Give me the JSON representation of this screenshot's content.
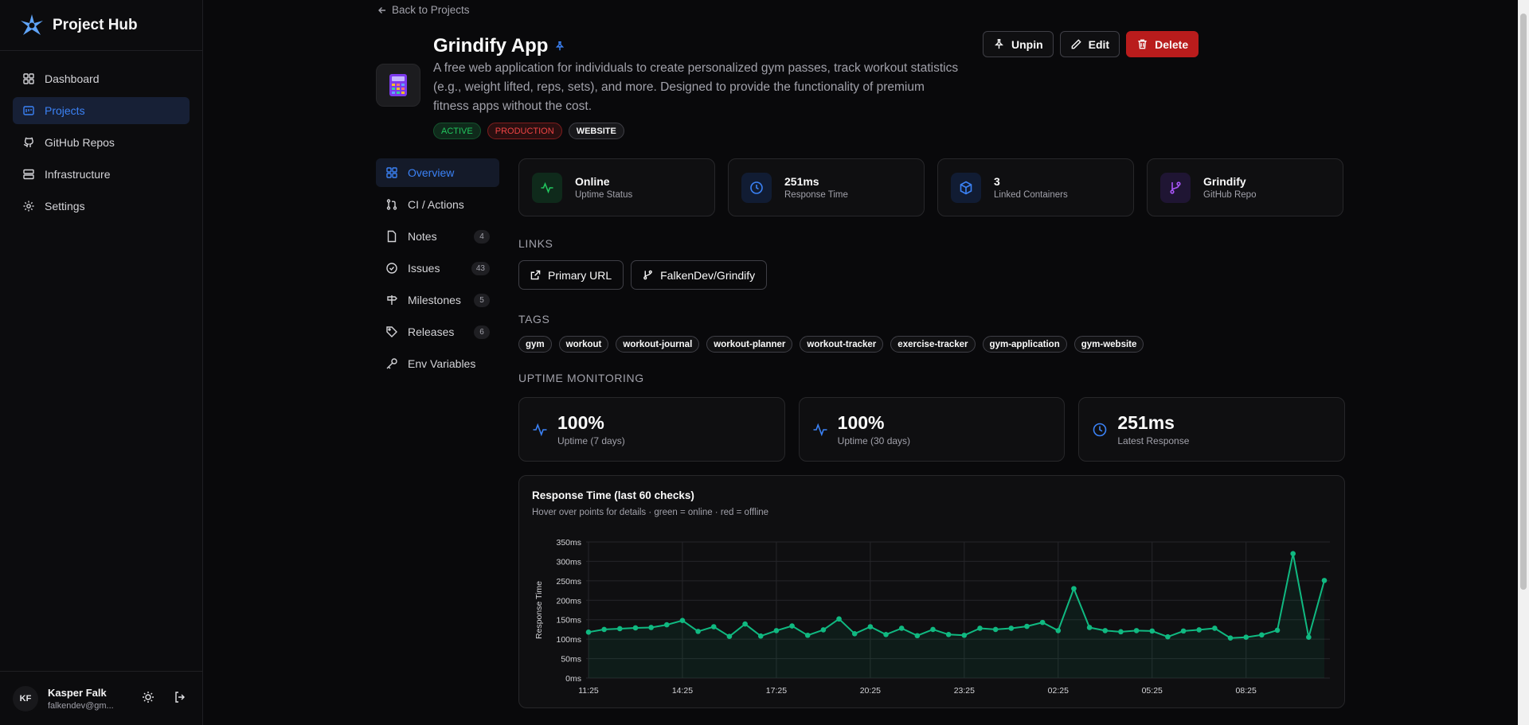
{
  "sidebar": {
    "brand": "Project Hub",
    "items": [
      {
        "label": "Dashboard",
        "icon": "dashboard-icon"
      },
      {
        "label": "Projects",
        "icon": "projects-icon",
        "active": true
      },
      {
        "label": "GitHub Repos",
        "icon": "github-icon"
      },
      {
        "label": "Infrastructure",
        "icon": "server-icon"
      },
      {
        "label": "Settings",
        "icon": "gear-icon"
      }
    ],
    "user": {
      "initials": "KF",
      "name": "Kasper Falk",
      "email": "falkendev@gm..."
    }
  },
  "back_label": "Back to Projects",
  "project": {
    "title": "Grindify App",
    "description": "A free web application for individuals to create personalized gym passes, track workout statistics (e.g., weight lifted, reps, sets), and more. Designed to provide the functionality of premium fitness apps without the cost.",
    "badges": [
      "ACTIVE",
      "PRODUCTION",
      "WEBSITE"
    ]
  },
  "actions": {
    "unpin": "Unpin",
    "edit": "Edit",
    "delete": "Delete"
  },
  "subnav": [
    {
      "label": "Overview",
      "count": null
    },
    {
      "label": "CI / Actions",
      "count": null
    },
    {
      "label": "Notes",
      "count": "4"
    },
    {
      "label": "Issues",
      "count": "43"
    },
    {
      "label": "Milestones",
      "count": "5"
    },
    {
      "label": "Releases",
      "count": "6"
    },
    {
      "label": "Env Variables",
      "count": null
    }
  ],
  "stats": [
    {
      "value": "Online",
      "label": "Uptime Status",
      "color": "#22c55e"
    },
    {
      "value": "251ms",
      "label": "Response Time",
      "color": "#3b82f6"
    },
    {
      "value": "3",
      "label": "Linked Containers",
      "color": "#3b82f6"
    },
    {
      "value": "Grindify",
      "label": "GitHub Repo",
      "color": "#a855f7"
    }
  ],
  "links_heading": "LINKS",
  "links": [
    {
      "label": "Primary URL"
    },
    {
      "label": "FalkenDev/Grindify"
    }
  ],
  "tags_heading": "TAGS",
  "tags": [
    "gym",
    "workout",
    "workout-journal",
    "workout-planner",
    "workout-tracker",
    "exercise-tracker",
    "gym-application",
    "gym-website"
  ],
  "uptime_heading": "UPTIME MONITORING",
  "uptime": [
    {
      "value": "100%",
      "label": "Uptime (7 days)"
    },
    {
      "value": "100%",
      "label": "Uptime (30 days)"
    },
    {
      "value": "251ms",
      "label": "Latest Response"
    }
  ],
  "chart_data": {
    "type": "line",
    "title": "Response Time (last 60 checks)",
    "subtitle": "Hover over points for details · green = online · red = offline",
    "ylabel": "Response Time",
    "xlabel": "",
    "ylim": [
      0,
      350
    ],
    "y_ticks": [
      "0ms",
      "50ms",
      "100ms",
      "150ms",
      "200ms",
      "250ms",
      "300ms",
      "350ms"
    ],
    "x_ticks": [
      "11:25",
      "14:25",
      "17:25",
      "20:25",
      "23:25",
      "02:25",
      "05:25",
      "08:25"
    ],
    "series": [
      {
        "name": "",
        "color": "#10b981",
        "values": [
          118,
          125,
          127,
          129,
          130,
          137,
          148,
          120,
          132,
          107,
          139,
          108,
          122,
          134,
          110,
          124,
          152,
          114,
          132,
          112,
          128,
          109,
          125,
          112,
          110,
          128,
          125,
          128,
          133,
          143,
          122,
          230,
          130,
          122,
          119,
          122,
          121,
          106,
          121,
          124,
          128,
          103,
          105,
          111,
          123,
          320,
          105,
          251
        ]
      }
    ]
  }
}
